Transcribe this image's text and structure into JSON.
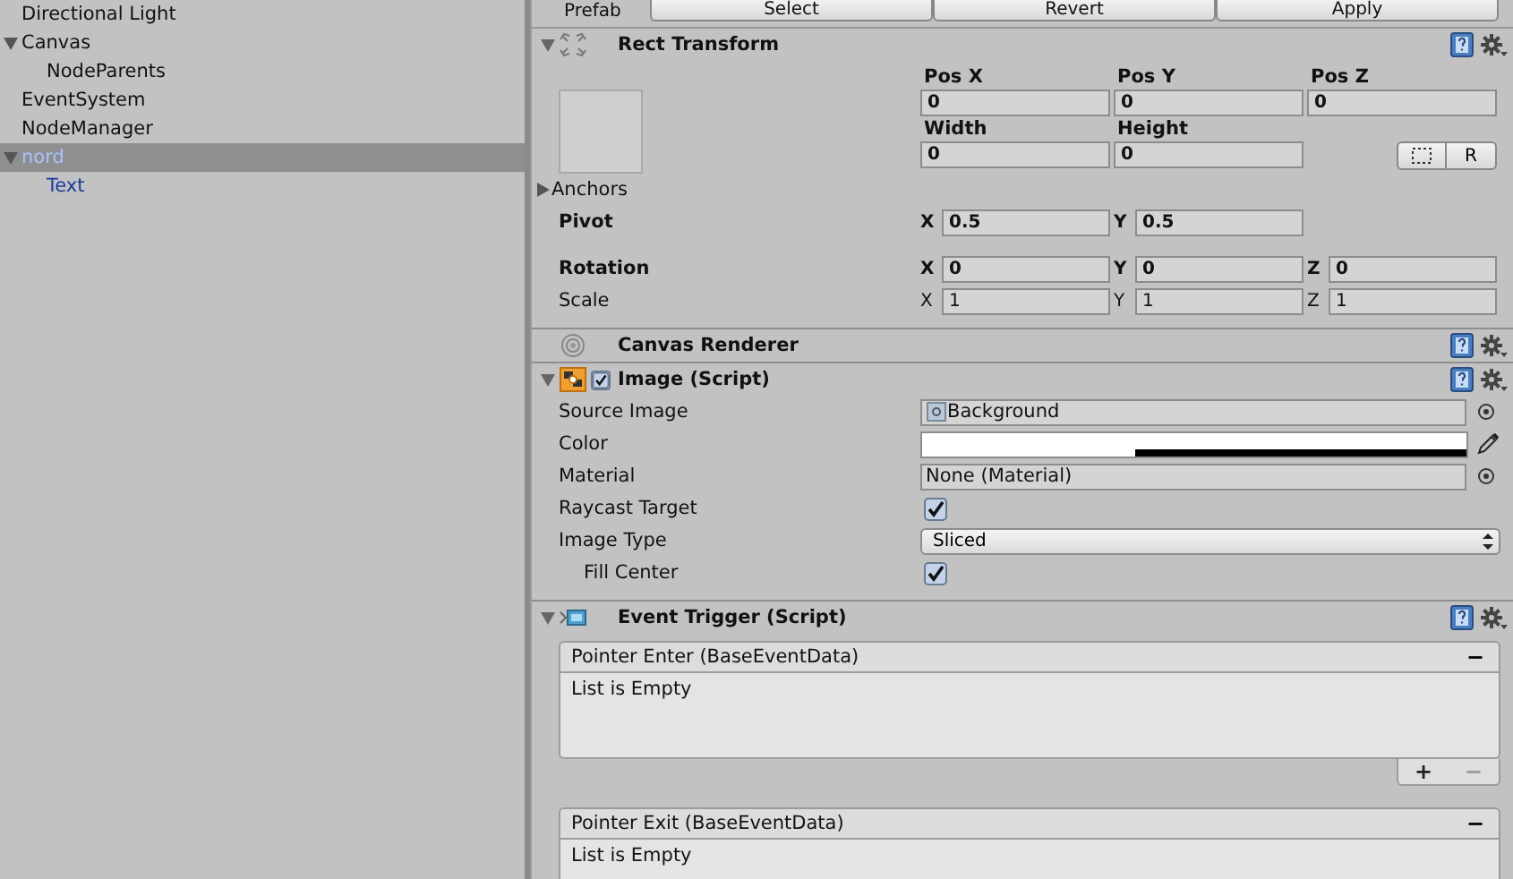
{
  "hierarchy": {
    "items": [
      {
        "label": "Directional Light",
        "selected": false,
        "prefab": false
      },
      {
        "label": "Canvas",
        "selected": false,
        "prefab": false,
        "expanded": true,
        "children": [
          {
            "label": "NodeParents",
            "selected": false,
            "prefab": false
          }
        ]
      },
      {
        "label": "EventSystem",
        "selected": false,
        "prefab": false
      },
      {
        "label": "NodeManager",
        "selected": false,
        "prefab": false
      },
      {
        "label": "nord",
        "selected": true,
        "prefab": true,
        "expanded": true,
        "children": [
          {
            "label": "Text",
            "selected": false,
            "prefab": true
          }
        ]
      }
    ]
  },
  "inspector": {
    "prefab_bar": {
      "label": "Prefab",
      "buttons": [
        "Select",
        "Revert",
        "Apply"
      ]
    },
    "components": [
      {
        "kind": "rect_transform",
        "title": "Rect Transform",
        "expanded": true,
        "pos_headers": [
          "Pos X",
          "Pos Y",
          "Pos Z"
        ],
        "pos_values": [
          "0",
          "0",
          "0"
        ],
        "size_headers": [
          "Width",
          "Height"
        ],
        "size_values": [
          "0",
          "0"
        ],
        "raw_button": "R",
        "anchors": {
          "label": "Anchors",
          "expanded": false
        },
        "vectors": [
          {
            "label": "Pivot",
            "bold": true,
            "axes": [
              {
                "axis": "X",
                "value": "0.5"
              },
              {
                "axis": "Y",
                "value": "0.5"
              }
            ]
          },
          {
            "label": "Rotation",
            "bold": true,
            "axes": [
              {
                "axis": "X",
                "value": "0"
              },
              {
                "axis": "Y",
                "value": "0"
              },
              {
                "axis": "Z",
                "value": "0"
              }
            ]
          },
          {
            "label": "Scale",
            "bold": false,
            "axes": [
              {
                "axis": "X",
                "value": "1"
              },
              {
                "axis": "Y",
                "value": "1"
              },
              {
                "axis": "Z",
                "value": "1"
              }
            ]
          }
        ]
      },
      {
        "kind": "canvas_renderer",
        "title": "Canvas Renderer"
      },
      {
        "kind": "image",
        "title": "Image (Script)",
        "expanded": true,
        "enabled": true,
        "properties": [
          {
            "kind": "object",
            "label": "Source Image",
            "value": "Background"
          },
          {
            "kind": "color",
            "label": "Color",
            "color": "#ffffff",
            "level": 0.39
          },
          {
            "kind": "object",
            "label": "Material",
            "value": "None (Material)"
          },
          {
            "kind": "checkbox",
            "label": "Raycast Target",
            "checked": true
          },
          {
            "kind": "dropdown",
            "label": "Image Type",
            "value": "Sliced"
          },
          {
            "kind": "checkbox",
            "label": "Fill Center",
            "checked": true,
            "indented": true
          }
        ]
      },
      {
        "kind": "event_trigger",
        "title": "Event Trigger (Script)",
        "expanded": true,
        "events": [
          {
            "title": "Pointer Enter (BaseEventData)",
            "remove": "−",
            "empty_text": "List is Empty",
            "footer_buttons": [
              {
                "label": "+",
                "disabled": false
              },
              {
                "label": "−",
                "disabled": true
              }
            ]
          },
          {
            "title": "Pointer Exit (BaseEventData)",
            "remove": "−",
            "empty_text": "List is Empty"
          }
        ]
      }
    ]
  }
}
